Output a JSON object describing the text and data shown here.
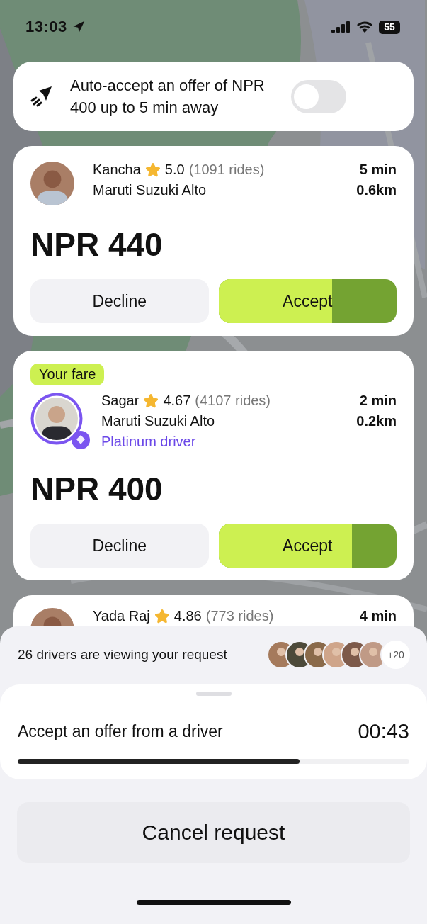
{
  "status_bar": {
    "time": "13:03",
    "battery": "55"
  },
  "auto_accept": {
    "text": "Auto-accept an offer of NPR 400 up to 5 min away",
    "on": false
  },
  "offers": [
    {
      "name": "Kancha",
      "rating": "5.0",
      "rides": "(1091 rides)",
      "car": "Maruti Suzuki Alto",
      "eta": "5 min",
      "distance": "0.6km",
      "price": "NPR 440",
      "decline": "Decline",
      "accept": "Accept",
      "level": 0.64
    },
    {
      "badge": "Your fare",
      "name": "Sagar",
      "rating": "4.67",
      "rides": "(4107 rides)",
      "car": "Maruti Suzuki Alto",
      "tier": "Platinum driver",
      "eta": "2 min",
      "distance": "0.2km",
      "price": "NPR 400",
      "decline": "Decline",
      "accept": "Accept",
      "level": 0.75
    },
    {
      "name": "Yada Raj",
      "rating": "4.86",
      "rides": "(773 rides)",
      "eta": "4 min"
    }
  ],
  "viewers": {
    "text": "26 drivers are viewing your request",
    "more": "+20"
  },
  "timer": {
    "title": "Accept an offer from a driver",
    "time": "00:43",
    "level": 0.72
  },
  "cancel_button": "Cancel request"
}
